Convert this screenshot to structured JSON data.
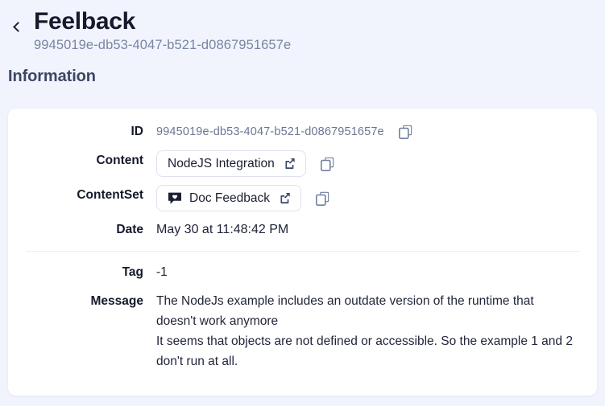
{
  "header": {
    "back_icon": "chevron-left-icon",
    "title": "Feelback",
    "subtitle": "9945019e-db53-4047-b521-d0867951657e"
  },
  "section": {
    "heading": "Information"
  },
  "fields": {
    "id": {
      "label": "ID",
      "value": "9945019e-db53-4047-b521-d0867951657e",
      "copy_icon": "copy-icon"
    },
    "content": {
      "label": "Content",
      "value": "NodeJS Integration",
      "external_icon": "external-link-icon",
      "copy_icon": "copy-icon"
    },
    "contentset": {
      "label": "ContentSet",
      "value": "Doc Feedback",
      "badge_icon": "speech-bubble-heart-icon",
      "external_icon": "external-link-icon",
      "copy_icon": "copy-icon"
    },
    "date": {
      "label": "Date",
      "value": "May 30 at 11:48:42 PM"
    },
    "tag": {
      "label": "Tag",
      "value": "-1"
    },
    "message": {
      "label": "Message",
      "paragraphs": [
        "The NodeJs example includes an outdate version of the runtime that doesn't work anymore",
        "It seems that objects are not defined or accessible. So the example 1 and 2 don't run at all."
      ]
    }
  },
  "colors": {
    "page_background": "#f1f4fd",
    "card_background": "#ffffff",
    "title_text": "#171a2c",
    "subtitle_text": "#7a84a3",
    "heading_text": "#3d4663",
    "muted_text": "#6b7693",
    "icon_slate": "#71809e",
    "border": "#dfe2ec",
    "divider": "#ecedf2"
  }
}
